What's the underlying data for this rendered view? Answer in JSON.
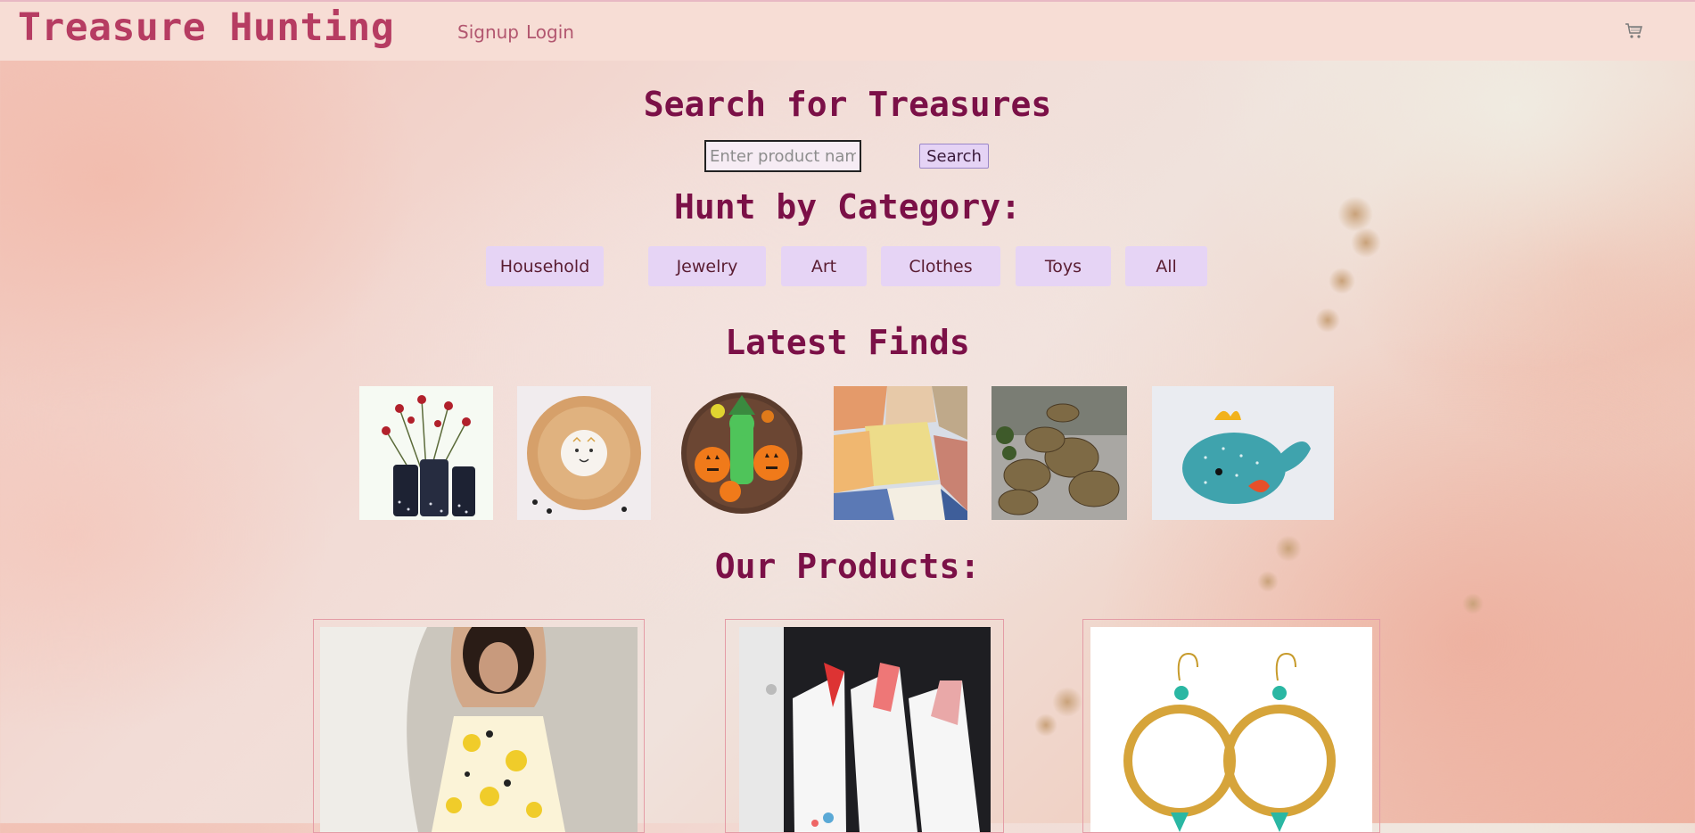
{
  "header": {
    "brand": "Treasure Hunting",
    "nav": {
      "signup": "Signup",
      "login": "Login"
    },
    "cart_icon": "shopping-cart-icon"
  },
  "search": {
    "title": "Search for Treasures",
    "placeholder": "Enter product name",
    "value": "",
    "button_label": "Search"
  },
  "categories": {
    "title": "Hunt by Category:",
    "items": [
      "Household",
      "Jewelry",
      "Art",
      "Clothes",
      "Toys",
      "All"
    ]
  },
  "latest": {
    "title": "Latest Finds",
    "items": [
      "vases-with-flowers-image",
      "lion-wall-hanging-image",
      "halloween-cookie-image",
      "handmade-soaps-image",
      "wicker-baskets-image",
      "whale-plush-image"
    ]
  },
  "products": {
    "title": "Our Products:",
    "items": [
      "yellow-floral-dress-image",
      "kitchen-towels-image",
      "gold-turquoise-earrings-image"
    ]
  },
  "colors": {
    "brand": "#b63c62",
    "heading": "#7b1047",
    "category_bg": "#e6d4f5",
    "header_bg": "#f7ddd5",
    "card_border": "#e49ca6"
  }
}
